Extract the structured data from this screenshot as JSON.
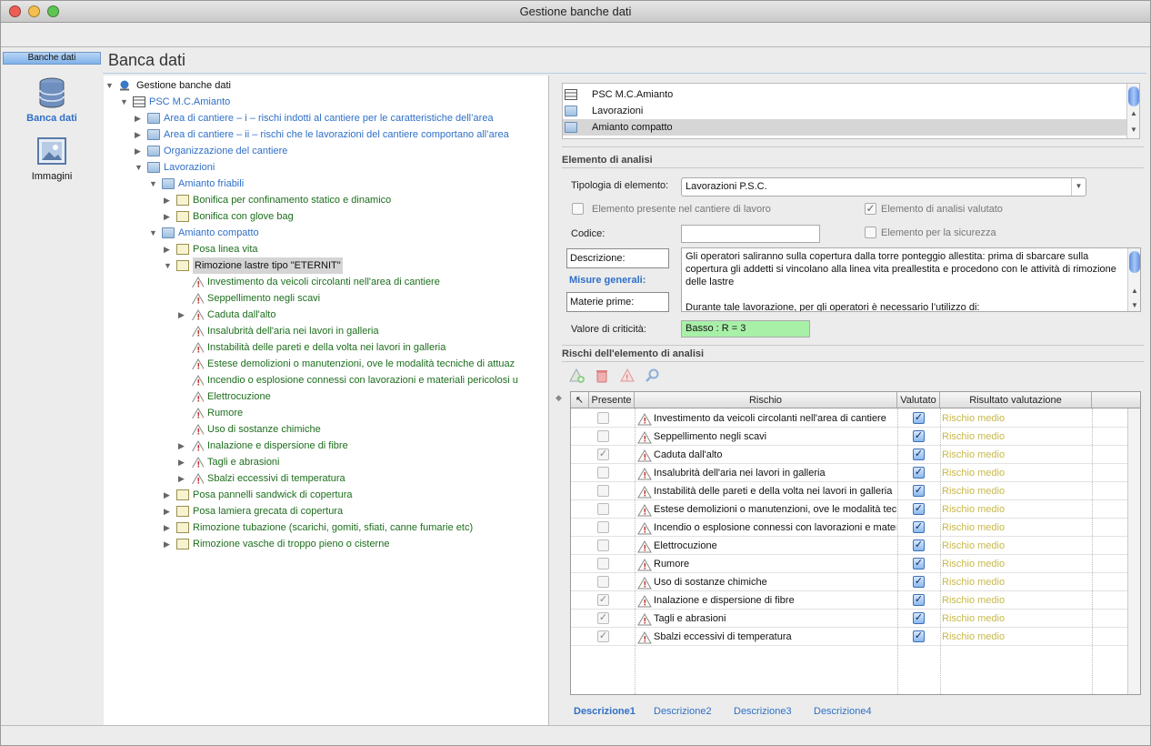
{
  "window": {
    "title": "Gestione banche dati"
  },
  "sidebar": {
    "header": "Banche dati",
    "items": [
      {
        "label": "Banca dati",
        "icon": "database-icon"
      },
      {
        "label": "Immagini",
        "icon": "image-icon"
      }
    ]
  },
  "page": {
    "title": "Banca dati"
  },
  "tree": {
    "root": "Gestione banche dati",
    "nodes": [
      {
        "label": "PSC M.C.Amianto",
        "level": 1,
        "expanded": true,
        "kind": "table",
        "color": "blue"
      },
      {
        "label": "Area di cantiere – i – rischi indotti al cantiere per le caratteristiche dell’area",
        "level": 2,
        "expanded": false,
        "kind": "folder",
        "color": "blue"
      },
      {
        "label": "Area di cantiere – ii – rischi che le lavorazioni del cantiere comportano all’area",
        "level": 2,
        "expanded": false,
        "kind": "folder",
        "color": "blue"
      },
      {
        "label": "Organizzazione del cantiere",
        "level": 2,
        "expanded": false,
        "kind": "folder",
        "color": "blue"
      },
      {
        "label": "Lavorazioni",
        "level": 2,
        "expanded": true,
        "kind": "folder",
        "color": "blue"
      },
      {
        "label": "Amianto friabili",
        "level": 3,
        "expanded": true,
        "kind": "folder",
        "color": "blue"
      },
      {
        "label": "Bonifica per confinamento statico e dinamico",
        "level": 4,
        "expanded": false,
        "kind": "doc",
        "color": "green"
      },
      {
        "label": "Bonifica con glove bag",
        "level": 4,
        "expanded": false,
        "kind": "doc",
        "color": "green"
      },
      {
        "label": "Amianto compatto",
        "level": 3,
        "expanded": true,
        "kind": "folder",
        "color": "blue"
      },
      {
        "label": "Posa linea vita",
        "level": 4,
        "expanded": false,
        "kind": "doc",
        "color": "green"
      },
      {
        "label": "Rimozione lastre tipo \"ETERNIT\"",
        "level": 4,
        "expanded": true,
        "kind": "doc",
        "color": "black",
        "selected": true
      },
      {
        "label": "Investimento da veicoli circolanti nell'area di cantiere",
        "level": 5,
        "kind": "warn",
        "color": "green"
      },
      {
        "label": "Seppellimento negli scavi",
        "level": 5,
        "kind": "warn",
        "color": "green"
      },
      {
        "label": "Caduta dall'alto",
        "level": 5,
        "kind": "warn",
        "color": "green",
        "expandable": true
      },
      {
        "label": "Insalubrità dell'aria nei lavori in galleria",
        "level": 5,
        "kind": "warn",
        "color": "green"
      },
      {
        "label": "Instabilità delle pareti e della volta nei lavori in galleria",
        "level": 5,
        "kind": "warn",
        "color": "green"
      },
      {
        "label": "Estese demolizioni o manutenzioni, ove le modalità tecniche di attuaz",
        "level": 5,
        "kind": "warn",
        "color": "green"
      },
      {
        "label": "Incendio o esplosione connessi con lavorazioni e materiali pericolosi u",
        "level": 5,
        "kind": "warn",
        "color": "green"
      },
      {
        "label": "Elettrocuzione",
        "level": 5,
        "kind": "warn",
        "color": "green"
      },
      {
        "label": "Rumore",
        "level": 5,
        "kind": "warn",
        "color": "green"
      },
      {
        "label": "Uso di sostanze chimiche",
        "level": 5,
        "kind": "warn",
        "color": "green"
      },
      {
        "label": "Inalazione e dispersione di fibre",
        "level": 5,
        "kind": "warn",
        "color": "green",
        "expandable": true
      },
      {
        "label": "Tagli e abrasioni",
        "level": 5,
        "kind": "warn",
        "color": "green",
        "expandable": true
      },
      {
        "label": "Sbalzi eccessivi di temperatura",
        "level": 5,
        "kind": "warn",
        "color": "green",
        "expandable": true
      },
      {
        "label": "Posa pannelli sandwick di copertura",
        "level": 4,
        "expanded": false,
        "kind": "doc",
        "color": "green"
      },
      {
        "label": "Posa lamiera grecata di copertura",
        "level": 4,
        "expanded": false,
        "kind": "doc",
        "color": "green"
      },
      {
        "label": "Rimozione tubazione (scarichi, gomiti, sfiati, canne fumarie etc)",
        "level": 4,
        "expanded": false,
        "kind": "doc",
        "color": "green"
      },
      {
        "label": "Rimozione vasche di troppo pieno o cisterne",
        "level": 4,
        "expanded": false,
        "kind": "doc",
        "color": "green"
      }
    ]
  },
  "breadcrumbs": [
    "PSC M.C.Amianto",
    "Lavorazioni",
    "Amianto compatto"
  ],
  "element": {
    "section_title": "Elemento di analisi",
    "tipologia_label": "Tipologia di elemento:",
    "tipologia_value": "Lavorazioni P.S.C.",
    "presente_label": "Elemento presente nel cantiere di lavoro",
    "valutato_label": "Elemento di analisi valutato",
    "codice_label": "Codice:",
    "codice_value": "",
    "sicurezza_label": "Elemento per la sicurezza",
    "descrizione_button": "Descrizione:",
    "misure_link": "Misure generali:",
    "materie_button": "Materie prime:",
    "description_text": "Gli operatori saliranno sulla copertura dalla torre ponteggio allestita: prima di sbarcare sulla copertura gli addetti si vincolano alla linea vita preallestita e procedono con le attività di rimozione delle lastre\n\nDurante tale lavorazione, per gli operatori è necessario l’utilizzo di:",
    "criticita_label": "Valore di criticità:",
    "criticita_value": "Basso : R = 3",
    "criticita_color": "#a8f0a8"
  },
  "risks": {
    "section_title": "Rischi dell'elemento di analisi",
    "columns": [
      "Presente",
      "Rischio",
      "Valutato",
      "Risultato valutazione"
    ],
    "rows": [
      {
        "presente": false,
        "rischio": "Investimento da veicoli circolanti nell'area di cantiere",
        "valutato": true,
        "risultato": "Rischio medio"
      },
      {
        "presente": false,
        "rischio": "Seppellimento negli scavi",
        "valutato": true,
        "risultato": "Rischio medio"
      },
      {
        "presente": true,
        "rischio": "Caduta dall'alto",
        "valutato": true,
        "risultato": "Rischio medio"
      },
      {
        "presente": false,
        "rischio": "Insalubrità dell'aria nei lavori in galleria",
        "valutato": true,
        "risultato": "Rischio medio"
      },
      {
        "presente": false,
        "rischio": "Instabilità delle pareti e della volta nei lavori in galleria",
        "valutato": true,
        "risultato": "Rischio medio"
      },
      {
        "presente": false,
        "rischio": "Estese demolizioni o manutenzioni, ove le modalità tecniche di attuazione",
        "valutato": true,
        "risultato": "Rischio medio"
      },
      {
        "presente": false,
        "rischio": "Incendio o esplosione connessi con lavorazioni e materiali pericolosi",
        "valutato": true,
        "risultato": "Rischio medio"
      },
      {
        "presente": false,
        "rischio": "Elettrocuzione",
        "valutato": true,
        "risultato": "Rischio medio"
      },
      {
        "presente": false,
        "rischio": "Rumore",
        "valutato": true,
        "risultato": "Rischio medio"
      },
      {
        "presente": false,
        "rischio": "Uso di sostanze chimiche",
        "valutato": true,
        "risultato": "Rischio medio"
      },
      {
        "presente": true,
        "rischio": "Inalazione e dispersione di fibre",
        "valutato": true,
        "risultato": "Rischio medio"
      },
      {
        "presente": true,
        "rischio": "Tagli e abrasioni",
        "valutato": true,
        "risultato": "Rischio medio"
      },
      {
        "presente": true,
        "rischio": "Sbalzi eccessivi di temperatura",
        "valutato": true,
        "risultato": "Rischio medio"
      }
    ],
    "result_color": "#c8b84a"
  },
  "tabs": [
    "Descrizione1",
    "Descrizione2",
    "Descrizione3",
    "Descrizione4"
  ]
}
